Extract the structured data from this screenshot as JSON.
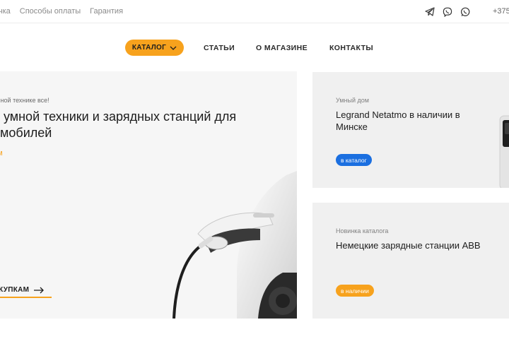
{
  "topbar": {
    "links": [
      "очка",
      "Способы оплаты",
      "Гарантия"
    ],
    "phone": "+375",
    "social_icons": [
      "telegram-icon",
      "viber-icon",
      "whatsapp-icon"
    ]
  },
  "nav": {
    "catalog": "КАТАЛОГ",
    "items": [
      "СТАТЬИ",
      "О МАГАЗИНЕ",
      "КОНТАКТЫ"
    ]
  },
  "hero": {
    "tag": "умной технике все!",
    "title": "н умной техники и зарядных станций для омобилей",
    "accent": "ом",
    "cta": "ОКУПКАМ"
  },
  "cards": [
    {
      "tag": "Умный дом",
      "title": "Legrand Netatmo в наличии в Минске",
      "badge": "в каталог",
      "badge_color": "#1b6fe0"
    },
    {
      "tag": "Новинка каталога",
      "title": "Немецкие зарядные станции ABB",
      "badge": "в наличии",
      "badge_color": "#f7a21d"
    }
  ],
  "colors": {
    "accent": "#f7a21d",
    "blue": "#1b6fe0"
  }
}
